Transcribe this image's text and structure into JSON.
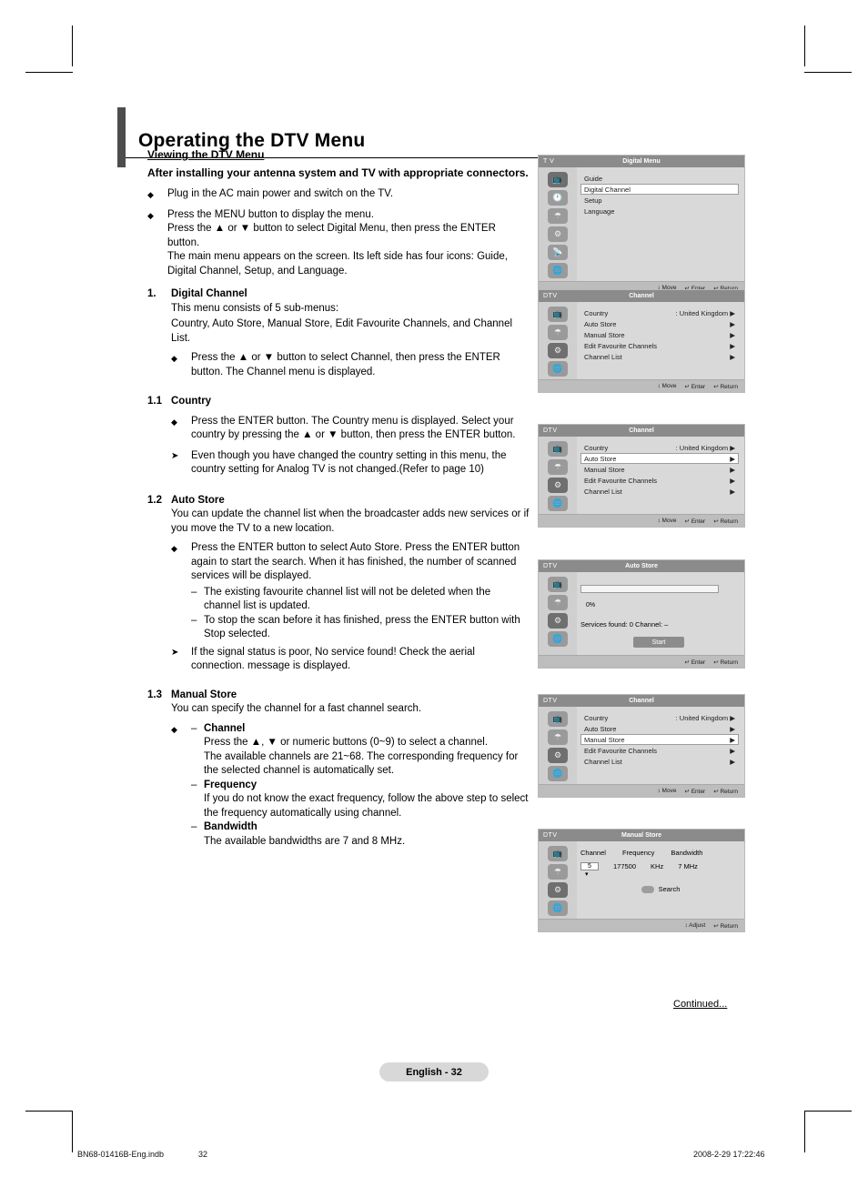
{
  "header": {
    "title": "Operating the DTV Menu"
  },
  "section": {
    "heading": "Viewing the DTV Menu",
    "intro": "After installing your antenna system and TV with appropriate connectors.",
    "bullets": [
      "Plug in the AC main power and switch on the TV.",
      "Press the MENU button to display the menu."
    ],
    "b2_line2": "Press the ▲ or ▼ button to select Digital Menu, then press the ENTER button.",
    "b2_line3": "The main menu appears on the screen. Its left side has four icons: Guide, Digital Channel, Setup, and Language."
  },
  "items": [
    {
      "num": "1.",
      "title": "Digital Channel",
      "line1": "This menu consists of 5 sub-menus:",
      "line2": "Country, Auto Store, Manual Store, Edit Favourite Channels, and Channel List.",
      "bullet": "Press the ▲ or ▼ button to select Channel, then press the ENTER button. The Channel menu is displayed."
    },
    {
      "num": "1.1",
      "title": "Country",
      "bullet1": "Press the ENTER button. The Country menu is displayed. Select your country by pressing the ▲ or ▼ button, then press the ENTER button.",
      "note1": "Even though you have changed the country setting in this menu, the country setting for Analog TV is not changed.(Refer to page 10)"
    },
    {
      "num": "1.2",
      "title": "Auto Store",
      "line1": "You can update the channel list when the broadcaster adds new services or if you move the TV to a new location.",
      "bullet1": "Press the ENTER button to select Auto Store. Press the ENTER button again to start the search. When it has finished, the number of scanned services will be displayed.",
      "dash1": "The existing favourite channel list will not be deleted when the channel list is updated.",
      "dash2": "To stop the scan before it has finished, press the ENTER button with Stop selected.",
      "note1": "If the signal status is poor, No service found! Check the aerial connection. message is displayed."
    },
    {
      "num": "1.3",
      "title": "Manual Store",
      "line1": "You can specify the channel for a fast channel search.",
      "sub": [
        {
          "label": "Channel",
          "text": "Press the ▲, ▼ or numeric buttons (0~9) to select a channel.\nThe available channels are 21~68. The corresponding frequency for the selected channel is automatically set."
        },
        {
          "label": "Frequency",
          "text": "If you do not know the exact frequency, follow the above step to select the frequency automatically using channel."
        },
        {
          "label": "Bandwidth",
          "text": "The available bandwidths are 7 and 8 MHz."
        }
      ]
    }
  ],
  "osd": {
    "panel1": {
      "tag": "T V",
      "title": "Digital Menu",
      "rows": [
        {
          "label": "Guide",
          "value": "",
          "selected": false
        },
        {
          "label": "Digital Channel",
          "value": "",
          "selected": true
        },
        {
          "label": "Setup",
          "value": "",
          "selected": false
        },
        {
          "label": "Language",
          "value": "",
          "selected": false
        }
      ],
      "footer": [
        "↕ Move",
        "↵ Enter",
        "↩ Return"
      ]
    },
    "panel2": {
      "tag": "DTV",
      "title": "Channel",
      "rows": [
        {
          "label": "Country",
          "value": ": United Kingdom ▶",
          "selected": false
        },
        {
          "label": "Auto Store",
          "value": "▶",
          "selected": false
        },
        {
          "label": "Manual Store",
          "value": "▶",
          "selected": false
        },
        {
          "label": "Edit Favourite Channels",
          "value": "▶",
          "selected": false
        },
        {
          "label": "Channel List",
          "value": "▶",
          "selected": false
        }
      ],
      "footer": [
        "↕ Move",
        "↵ Enter",
        "↩ Return"
      ]
    },
    "panel3": {
      "tag": "DTV",
      "title": "Channel",
      "rows": [
        {
          "label": "Country",
          "value": ": United Kingdom ▶",
          "selected": false
        },
        {
          "label": "Auto Store",
          "value": "▶",
          "selected": true
        },
        {
          "label": "Manual Store",
          "value": "▶",
          "selected": false
        },
        {
          "label": "Edit Favourite Channels",
          "value": "▶",
          "selected": false
        },
        {
          "label": "Channel List",
          "value": "▶",
          "selected": false
        }
      ],
      "footer": [
        "↕ Move",
        "↵ Enter",
        "↩ Return"
      ]
    },
    "panel4": {
      "tag": "DTV",
      "title": "Auto Store",
      "percent": "0%",
      "status": "Services found: 0     Channel: –",
      "button": "Start",
      "footer": [
        "↵ Enter",
        "↩ Return"
      ]
    },
    "panel5": {
      "tag": "DTV",
      "title": "Channel",
      "rows": [
        {
          "label": "Country",
          "value": ": United Kingdom ▶",
          "selected": false
        },
        {
          "label": "Auto Store",
          "value": "▶",
          "selected": false
        },
        {
          "label": "Manual Store",
          "value": "▶",
          "selected": true
        },
        {
          "label": "Edit Favourite Channels",
          "value": "▶",
          "selected": false
        },
        {
          "label": "Channel List",
          "value": "▶",
          "selected": false
        }
      ],
      "footer": [
        "↕ Move",
        "↵ Enter",
        "↩ Return"
      ]
    },
    "panel6": {
      "tag": "DTV",
      "title": "Manual Store",
      "headers": [
        "Channel",
        "Frequency",
        "Bandwidth"
      ],
      "values": [
        "5",
        "177500",
        "KHz",
        "7 MHz"
      ],
      "search": "Search",
      "footer": [
        "↕ Adjust",
        "↩ Return"
      ]
    }
  },
  "continued": "Continued...",
  "page_badge": "English - 32",
  "footer": {
    "left": "BN68-01416B-Eng.indb",
    "center": "32",
    "right": "2008-2-29   17:22:46"
  }
}
